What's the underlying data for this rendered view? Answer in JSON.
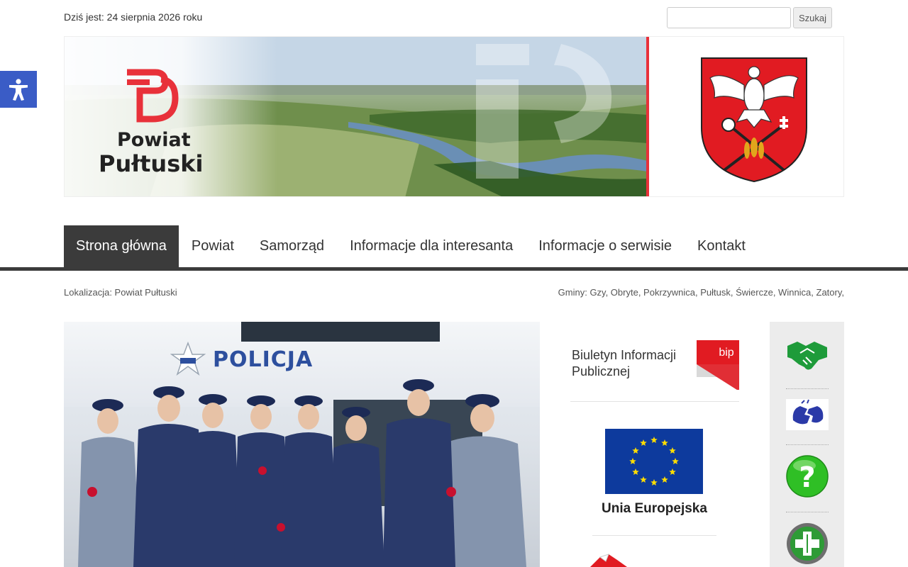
{
  "top_bar": {
    "date_text": "Dziś jest: 24 sierpnia 2026 roku",
    "search": {
      "value": "",
      "placeholder": ""
    },
    "search_button": "Szukaj"
  },
  "accessibility": {
    "icon": "accessibility-person-icon",
    "color": "#3a5cc6"
  },
  "header": {
    "logo": {
      "line1": "Powiat",
      "line2": "Pułtuski",
      "brand_color": "#e8313a"
    },
    "crest_icon": "coat-of-arms-icon"
  },
  "nav": {
    "items": [
      {
        "label": "Strona główna",
        "active": true
      },
      {
        "label": "Powiat",
        "active": false
      },
      {
        "label": "Samorząd",
        "active": false
      },
      {
        "label": "Informacje dla interesanta",
        "active": false
      },
      {
        "label": "Informacje o serwisie",
        "active": false
      },
      {
        "label": "Kontakt",
        "active": false
      }
    ],
    "bar_color": "#3b3b3b"
  },
  "location": {
    "text": "Lokalizacja: Powiat Pułtuski",
    "gminy": "Gminy: Gzy, Obryte, Pokrzywnica, Pułtusk, Świercze, Winnica, Zatory,"
  },
  "news": {
    "photo_sign": "POLICJA",
    "photo_badge": "POLICJA"
  },
  "links": {
    "bip": {
      "text_line1": "Biuletyn Informacji",
      "text_line2": "Publicznej",
      "badge": "bip"
    },
    "eu": {
      "label": "Unia Europejska",
      "flag_color": "#0d3a9d",
      "star_color": "#ffdd00"
    }
  },
  "sidebar": {
    "icons": [
      "handshake-icon",
      "sign-language-icon",
      "question-mark-icon",
      "pharmacy-cross-icon"
    ]
  }
}
